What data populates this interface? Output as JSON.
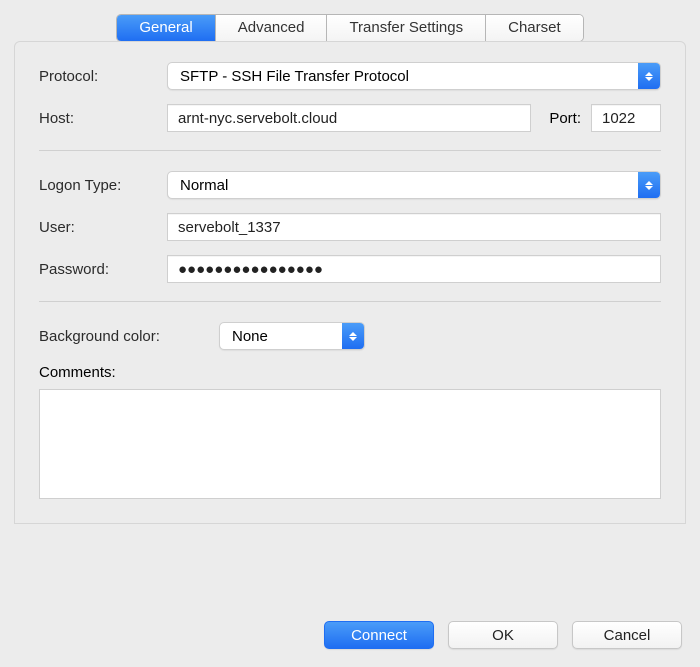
{
  "tabs": {
    "general": "General",
    "advanced": "Advanced",
    "transfer": "Transfer Settings",
    "charset": "Charset"
  },
  "labels": {
    "protocol": "Protocol:",
    "host": "Host:",
    "port": "Port:",
    "logon_type": "Logon Type:",
    "user": "User:",
    "password": "Password:",
    "bg_color": "Background color:",
    "comments": "Comments:"
  },
  "values": {
    "protocol": "SFTP - SSH File Transfer Protocol",
    "host": "arnt-nyc.servebolt.cloud",
    "port": "1022",
    "logon_type": "Normal",
    "user": "servebolt_1337",
    "password": "●●●●●●●●●●●●●●●●",
    "bg_color": "None",
    "comments": ""
  },
  "buttons": {
    "connect": "Connect",
    "ok": "OK",
    "cancel": "Cancel"
  }
}
